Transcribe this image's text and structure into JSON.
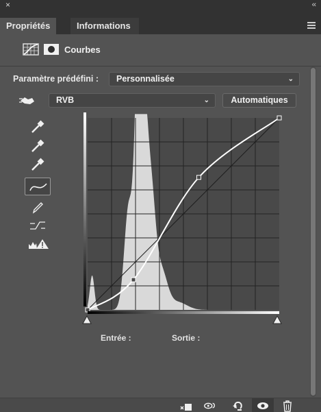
{
  "window": {
    "close_glyph": "×",
    "collapse_glyph": "‹‹"
  },
  "tabs": [
    {
      "label": "Propriétés",
      "active": true
    },
    {
      "label": "Informations",
      "active": false
    }
  ],
  "header": {
    "title": "Courbes",
    "icons": [
      "curves-adjustment-icon",
      "mask-icon"
    ]
  },
  "preset": {
    "label": "Paramètre prédéfini :",
    "value": "Personnalisée"
  },
  "channel": {
    "value": "RVB"
  },
  "auto_button": {
    "label": "Automatiques"
  },
  "tools": [
    "targeted-adjustment-icon",
    "black-point-eyedropper-icon",
    "gray-point-eyedropper-icon",
    "white-point-eyedropper-icon",
    "curve-point-tool-icon",
    "pencil-draw-icon",
    "smooth-curve-icon",
    "clipping-warning-icon"
  ],
  "graph": {
    "input_label": "Entrée :",
    "output_label": "Sortie :",
    "curve_points": [
      {
        "input": 0,
        "output": 0
      },
      {
        "input": 61,
        "output": 40
      },
      {
        "input": 148,
        "output": 176
      },
      {
        "input": 255,
        "output": 255
      }
    ],
    "histogram_color": "#d9d9d9",
    "grid_background": "#494949"
  },
  "bottom_icons": [
    "clip-to-layer-icon",
    "view-previous-state-icon",
    "reset-adjustments-icon",
    "visibility-eye-icon",
    "delete-trash-icon"
  ],
  "colors": {
    "panel_bg": "#535353",
    "tab_bar": "#323232",
    "curve": "#ffffff"
  }
}
